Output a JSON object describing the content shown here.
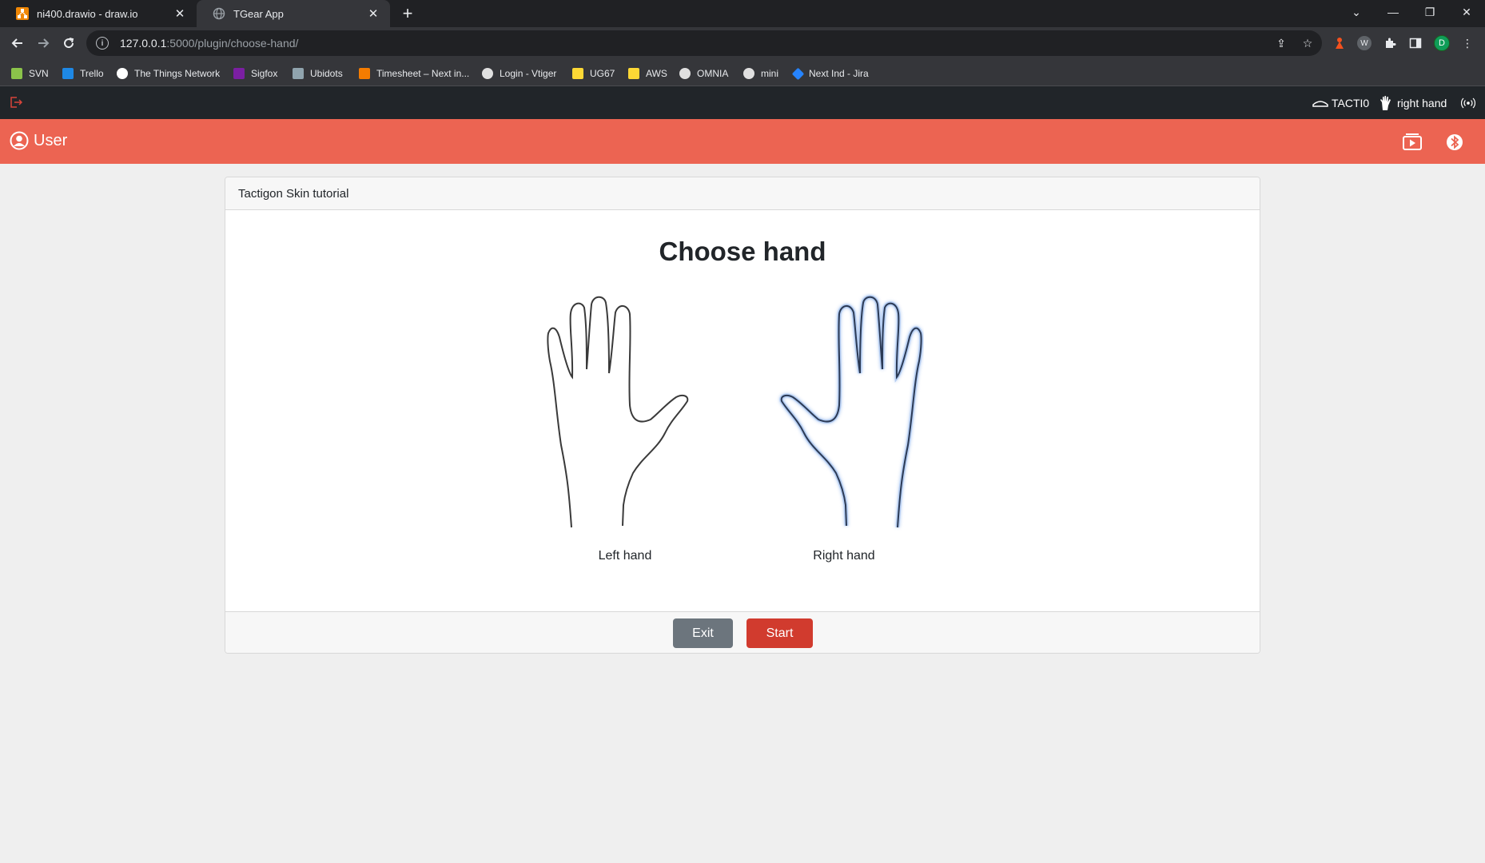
{
  "browser": {
    "tabs": [
      {
        "title": "ni400.drawio - draw.io",
        "icon": "drawio-icon",
        "active": false
      },
      {
        "title": "TGear App",
        "icon": "globe-icon",
        "active": true
      }
    ],
    "new_tab": "+",
    "url_host": "127.0.0.1",
    "url_path": ":5000/plugin/choose-hand/",
    "profile_initial": "D",
    "bookmarks": [
      {
        "label": "SVN",
        "color": "#8bc34a"
      },
      {
        "label": "Trello",
        "color": "#1e88e5"
      },
      {
        "label": "The Things Network",
        "color": "#ffffff"
      },
      {
        "label": "Sigfox",
        "color": "#7b1fa2"
      },
      {
        "label": "Ubidots",
        "color": "#90a4ae"
      },
      {
        "label": "Timesheet – Next in...",
        "color": "#f57c00"
      },
      {
        "label": "Login - Vtiger",
        "color": "#e0e0e0"
      },
      {
        "label": "UG67",
        "color": "#fdd835"
      },
      {
        "label": "AWS",
        "color": "#fdd835"
      },
      {
        "label": "OMNIA",
        "color": "#e0e0e0"
      },
      {
        "label": "mini",
        "color": "#e0e0e0"
      },
      {
        "label": "Next Ind - Jira",
        "color": "#2684ff"
      }
    ]
  },
  "app": {
    "topbar": {
      "device": "TACTI0",
      "hand": "right hand"
    },
    "header": {
      "user_label": "User"
    },
    "card": {
      "header": "Tactigon Skin tutorial",
      "title": "Choose hand",
      "left_label": "Left hand",
      "right_label": "Right hand",
      "selected": "right"
    },
    "buttons": {
      "exit": "Exit",
      "start": "Start"
    },
    "colors": {
      "header": "#ec6452",
      "topbar": "#212529",
      "start": "#d13b2e",
      "exit": "#6c757d",
      "selected_glow": "#4a7fd4"
    }
  }
}
